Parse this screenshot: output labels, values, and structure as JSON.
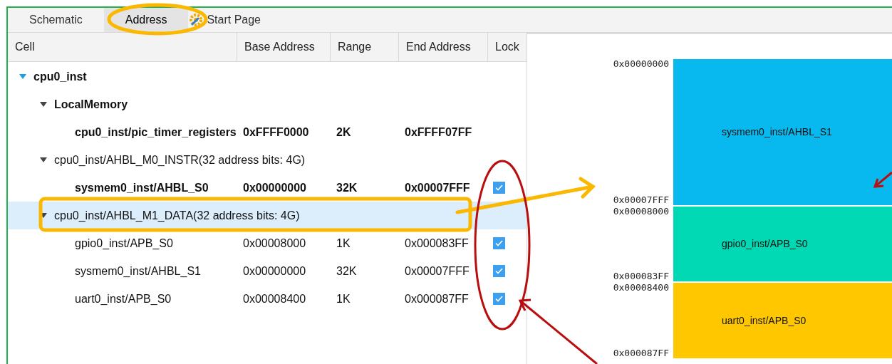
{
  "tabs": [
    {
      "label": "Schematic",
      "selected": false
    },
    {
      "label": "Address",
      "selected": true
    },
    {
      "label": "Start Page",
      "selected": false,
      "kind": "start"
    }
  ],
  "table": {
    "columns": [
      "Cell",
      "Base Address",
      "Range",
      "End Address",
      "Lock"
    ],
    "rows": [
      {
        "cell": "cpu0_inst",
        "expanded": true,
        "selected": false,
        "bold": true,
        "children": [
          {
            "cell": "LocalMemory",
            "expanded": true,
            "selected": false,
            "bold": true,
            "children": [
              {
                "cell": "cpu0_inst/pic_timer_registers",
                "base": "0xFFFF0000",
                "range": "2K",
                "end": "0xFFFF07FF",
                "selected": false,
                "bold": true
              }
            ]
          },
          {
            "cell": "cpu0_inst/AHBL_M0_INSTR(32 address bits: 4G)",
            "expanded": true,
            "selected": false,
            "bold": false,
            "children": [
              {
                "cell": "sysmem0_inst/AHBL_S0",
                "base": "0x00000000",
                "range": "32K",
                "end": "0x00007FFF",
                "selected": false,
                "bold": true,
                "locked": true
              }
            ]
          },
          {
            "cell": "cpu0_inst/AHBL_M1_DATA(32 address bits: 4G)",
            "expanded": true,
            "selected": true,
            "bold": false,
            "children": [
              {
                "cell": "gpio0_inst/APB_S0",
                "base": "0x00008000",
                "range": "1K",
                "end": "0x000083FF",
                "selected": false,
                "bold": false,
                "locked": true
              },
              {
                "cell": "sysmem0_inst/AHBL_S1",
                "base": "0x00000000",
                "range": "32K",
                "end": "0x00007FFF",
                "selected": false,
                "bold": false,
                "locked": true
              },
              {
                "cell": "uart0_inst/APB_S0",
                "base": "0x00008400",
                "range": "1K",
                "end": "0x000087FF",
                "selected": false,
                "bold": false,
                "locked": true
              }
            ]
          }
        ]
      }
    ]
  },
  "memory_map": {
    "blocks": [
      {
        "label": "sysmem0_inst/AHBL_S1",
        "start": "0x00000000",
        "end": "0x00007FFF",
        "color": "#08b9f0"
      },
      {
        "label": "gpio0_inst/APB_S0",
        "start": "0x00008000",
        "end": "0x000083FF",
        "color": "#00d9b3"
      },
      {
        "label": "uart0_inst/APB_S0",
        "start": "0x00008400",
        "end": "0x000087FF",
        "color": "#ffc700"
      }
    ]
  }
}
